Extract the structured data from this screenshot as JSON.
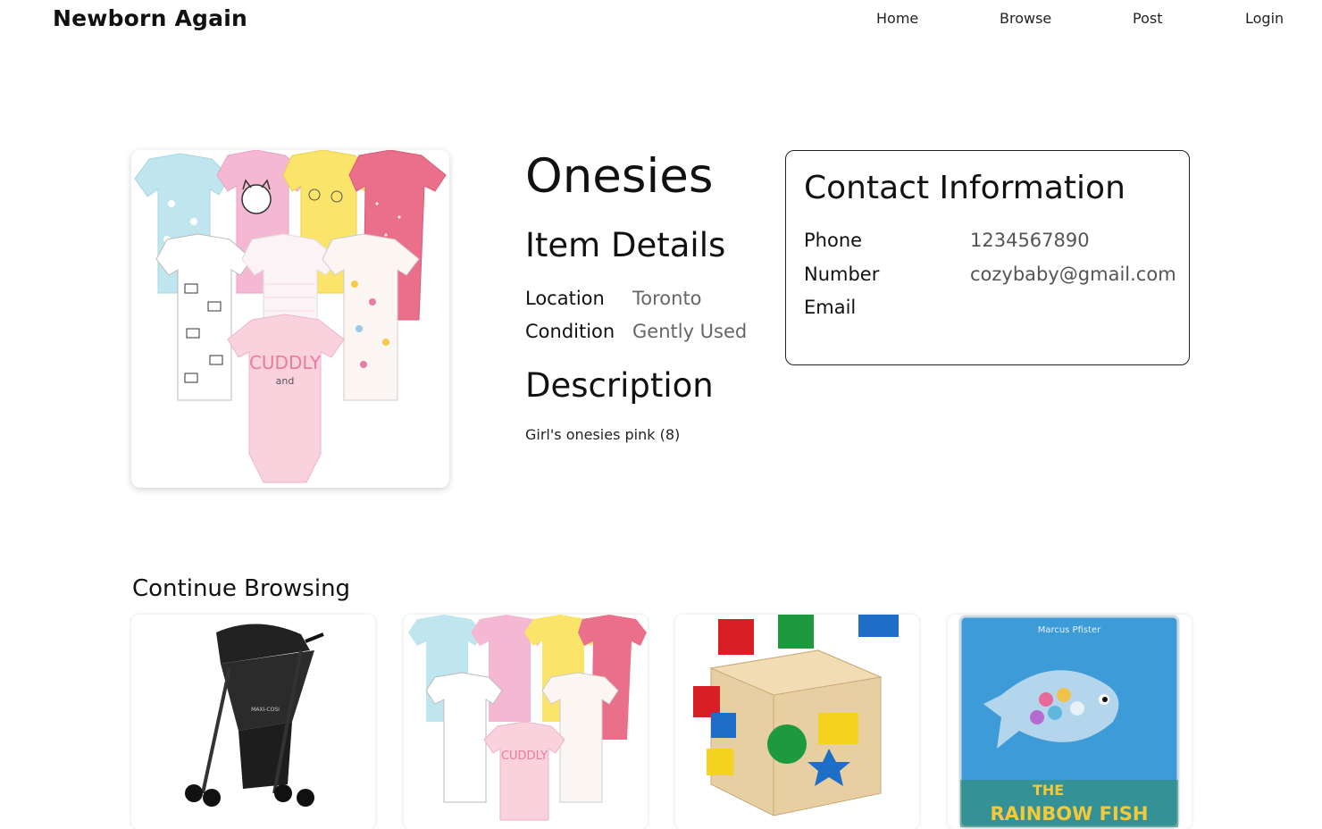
{
  "nav": {
    "brand": "Newborn Again",
    "links": [
      "Home",
      "Browse",
      "Post",
      "Login"
    ]
  },
  "item": {
    "title": "Onesies",
    "details_heading": "Item Details",
    "location_label": "Location",
    "location_value": "Toronto",
    "condition_label": "Condition",
    "condition_value": "Gently Used",
    "description_heading": "Description",
    "description_text": "Girl's onesies pink (8)",
    "onesie_print": "CUDDLY",
    "onesie_print_2": "and"
  },
  "contact": {
    "heading": "Contact Information",
    "labels": [
      "Phone",
      "Number",
      "Email"
    ],
    "values": [
      "1234567890",
      "cozybaby@gmail.com"
    ]
  },
  "browse": {
    "heading": "Continue Browsing",
    "book_author": "Marcus Pfister",
    "book_title_1": "THE",
    "book_title_2": "RAINBOW FISH",
    "stroller_brand": "MAXI-COSI"
  }
}
